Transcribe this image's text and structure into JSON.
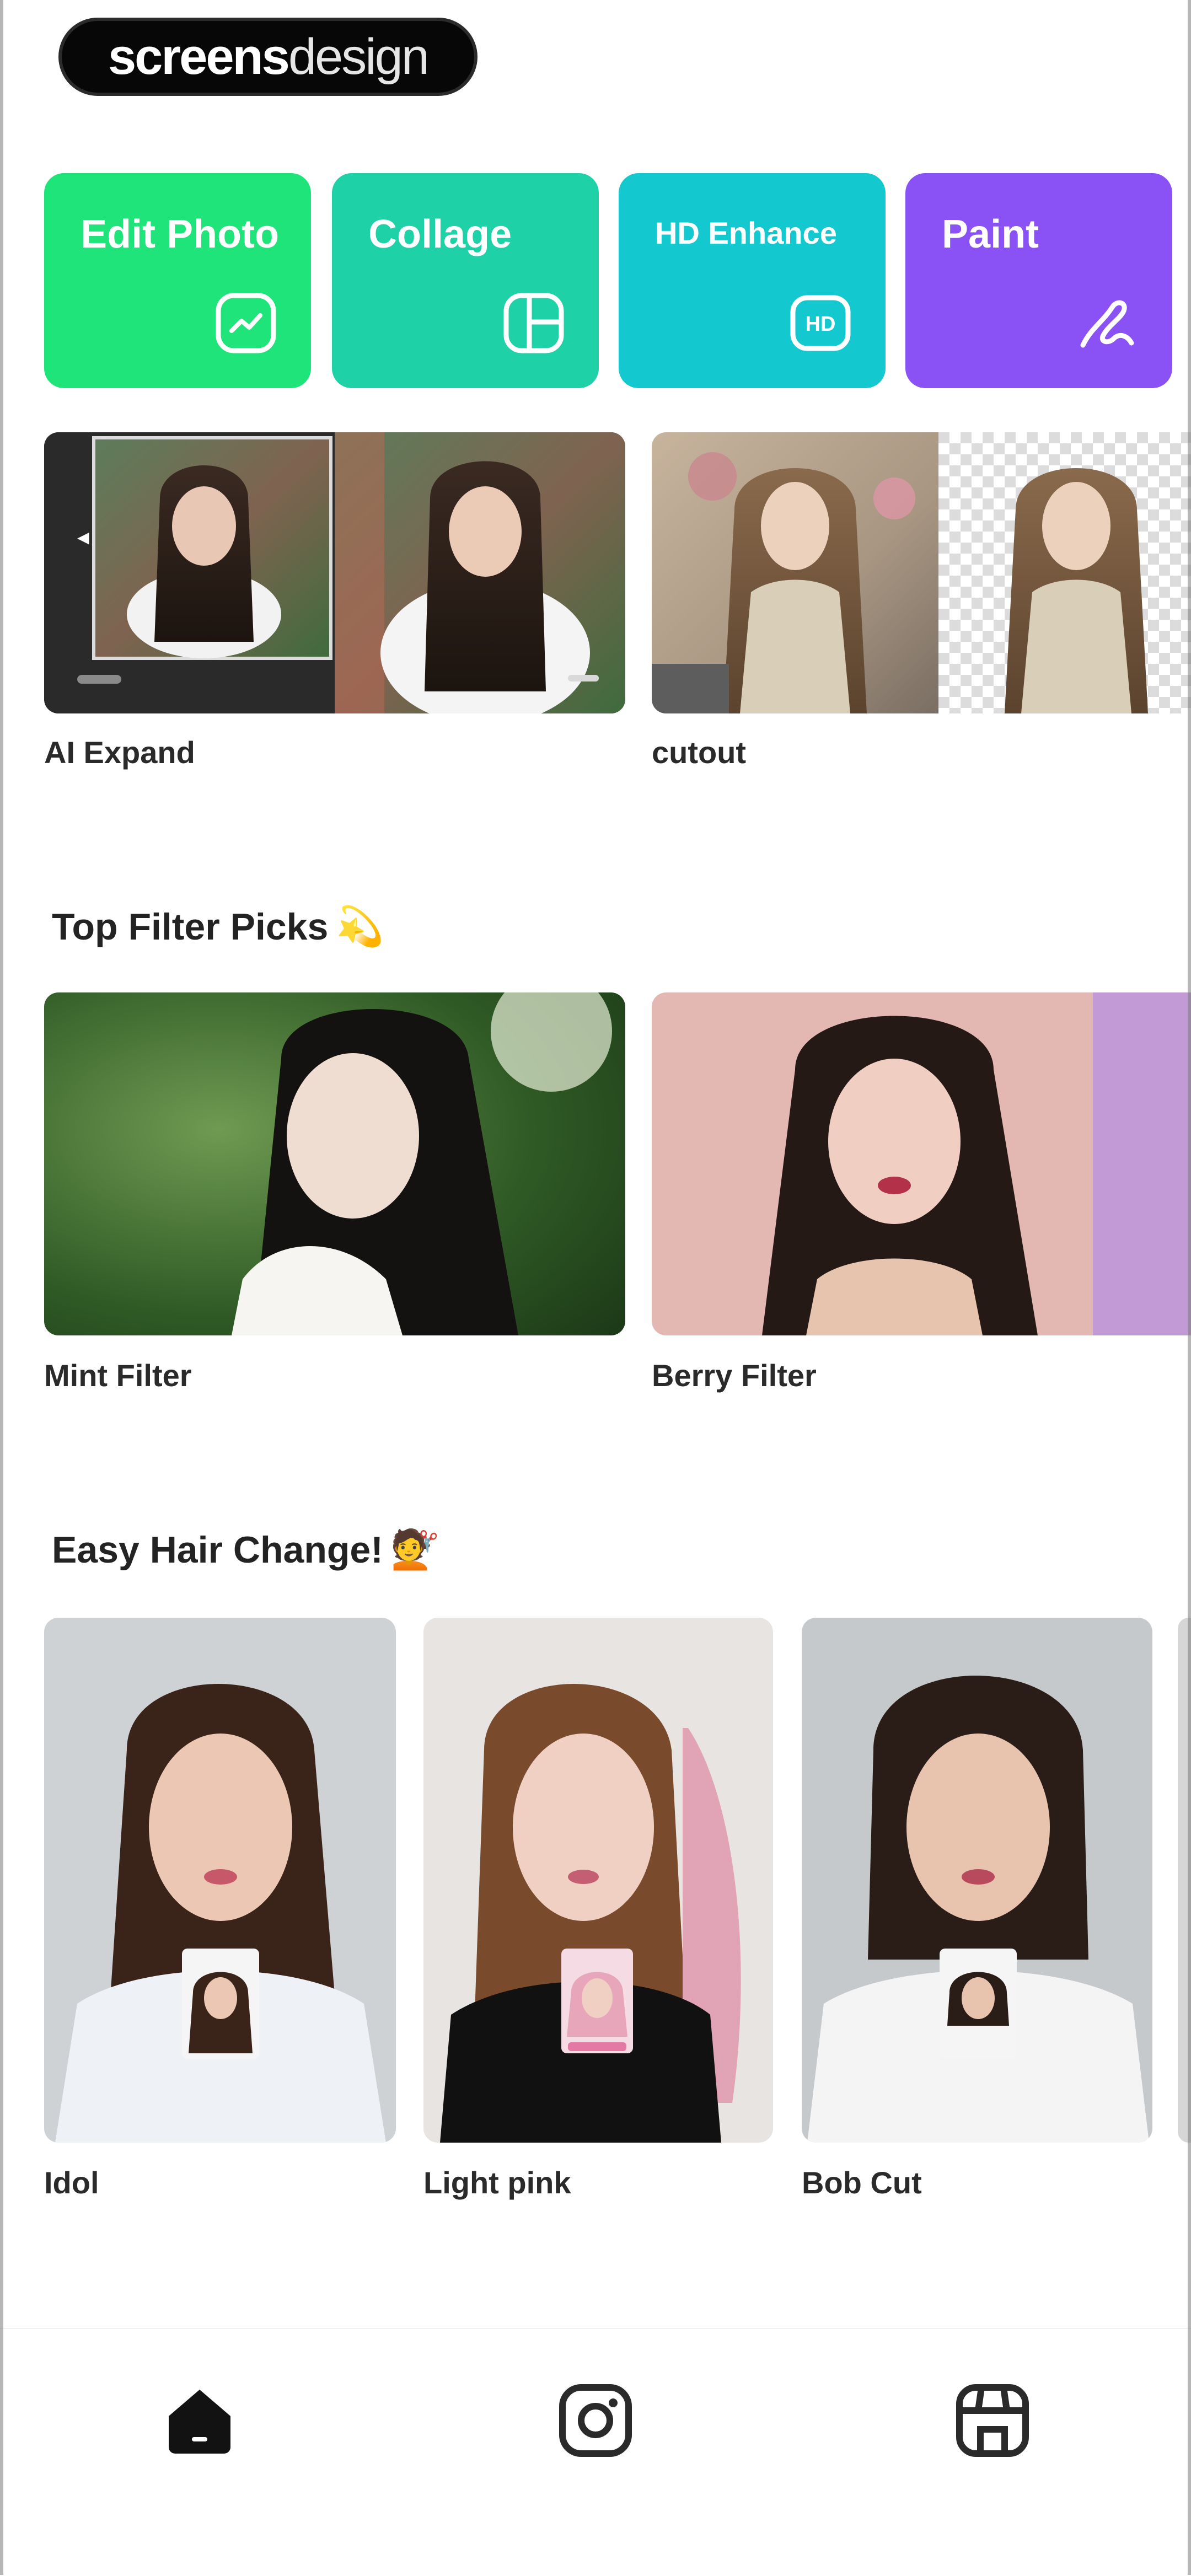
{
  "watermark": {
    "brand_bold": "screens",
    "brand_light": "design"
  },
  "tools": [
    {
      "label": "Edit Photo",
      "color": "#1fe47a",
      "icon": "edit-photo-icon"
    },
    {
      "label": "Collage",
      "color": "#1ed1a6",
      "icon": "collage-icon"
    },
    {
      "label": "HD Enhance",
      "color": "#14c8cf",
      "icon": "hd-icon"
    },
    {
      "label": "Paint",
      "color": "#8a52f5",
      "icon": "paint-brush-icon"
    }
  ],
  "ai_tools": [
    {
      "label": "AI Expand"
    },
    {
      "label": "cutout"
    }
  ],
  "filters": {
    "title": "Top Filter Picks",
    "emoji": "💫",
    "items": [
      {
        "label": "Mint Filter"
      },
      {
        "label": "Berry Filter"
      }
    ]
  },
  "hair": {
    "title": "Easy Hair Change!",
    "emoji": "💇",
    "items": [
      {
        "label": "Idol"
      },
      {
        "label": "Light pink"
      },
      {
        "label": "Bob Cut"
      }
    ]
  },
  "nav": [
    {
      "name": "home",
      "icon": "home-icon",
      "active": true
    },
    {
      "name": "instagram",
      "icon": "instagram-icon",
      "active": false
    },
    {
      "name": "store",
      "icon": "store-icon",
      "active": false
    }
  ],
  "colors": {
    "accent_green": "#1fe47a",
    "accent_teal": "#1ed1a6",
    "accent_cyan": "#14c8cf",
    "accent_purple": "#8a52f5"
  }
}
